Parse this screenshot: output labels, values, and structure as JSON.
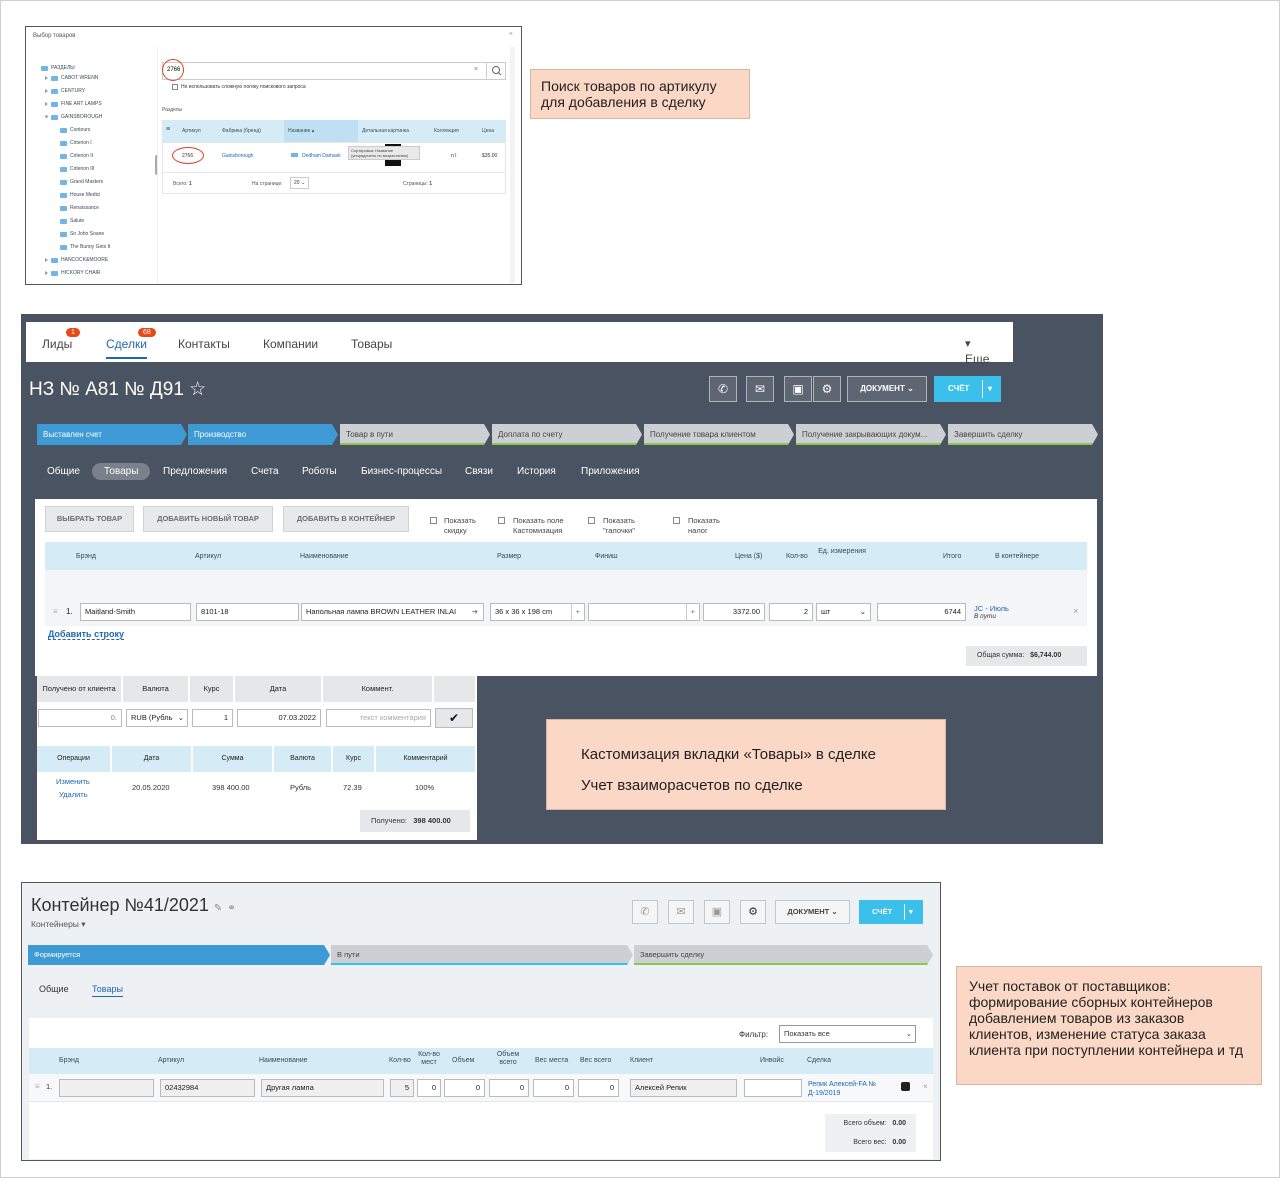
{
  "panel1": {
    "dialog_title": "Выбор товаров",
    "close": "×",
    "tree": [
      "РАЗДЕЛЫ",
      "CABOT WRENN",
      "CENTURY",
      "FINE ART LAMPS",
      "GAINSBOROUGH",
      "Contours",
      "Criterion I",
      "Criterion II",
      "Criterion III",
      "Grand Masters",
      "House Medici",
      "Renaissance",
      "Salute",
      "Sir John Soane",
      "The Bunny Gets It",
      "HANCOCK&MOORE",
      "HICKORY CHAIR"
    ],
    "search_value": "2766",
    "checkbox_label": "Не использовать сложную логику поискового запроса",
    "section_label": "Разделы",
    "columns": [
      "Артикул",
      "Фабрика (бренд)",
      "Название",
      "Детальная картинка",
      "Коллекция",
      "Цена"
    ],
    "row": {
      "article": "2766",
      "brand": "Gainsborough",
      "name": "Dedham Damask",
      "collection": "n I",
      "price": "$35.00"
    },
    "tooltip": "Сортировка: Название (упорядочено по возрастанию)",
    "footer": {
      "total_label": "Всего:",
      "total": "1",
      "per_page_label": "На странице:",
      "per_page": "20",
      "pages_label": "Страницы:",
      "pages": "1"
    }
  },
  "note1": "Поиск товаров по артикулу для добавления в сделку",
  "panel2": {
    "tabs": [
      "Лиды",
      "Сделки",
      "Контакты",
      "Компании",
      "Товары",
      "Еще"
    ],
    "badges": [
      "1",
      "68"
    ],
    "title": "НЗ № А81 № Д91 ☆",
    "doc_button": "ДОКУМЕНТ",
    "schet_button": "СЧЁТ",
    "stages": [
      "Выставлен счет",
      "Производство",
      "Товар в пути",
      "Доплата по счету",
      "Получение товара клиентом",
      "Получение закрывающих докум...",
      "Завершить сделку"
    ],
    "subtabs": [
      "Общие",
      "Товары",
      "Предложения",
      "Счета",
      "Роботы",
      "Бизнес-процессы",
      "Связи",
      "История",
      "Приложения"
    ],
    "buttons": [
      "ВЫБРАТЬ ТОВАР",
      "ДОБАВИТЬ НОВЫЙ ТОВАР",
      "ДОБАВИТЬ В КОНТЕЙНЕР"
    ],
    "checkboxes": [
      "Показать скидку",
      "Показать поле Кастомизация",
      "Показать \"галочки\"",
      "Показать налог"
    ],
    "columns": [
      "Брэнд",
      "Артикул",
      "Наименование",
      "Размер",
      "Финиш",
      "Цена ($)",
      "Кол-во",
      "Ед. измерения",
      "Итого",
      "В контейнере"
    ],
    "row": {
      "num": "1.",
      "brand": "Maitland-Smith",
      "article": "8101-18",
      "name": "Напольная лампа BROWN LEATHER INLAI",
      "size": "36 x 36 x 198 cm",
      "finish": "",
      "price": "3372.00",
      "qty": "2",
      "unit": "шт",
      "total": "6744",
      "container": "JC - Июль",
      "container_status": "В пути"
    },
    "add_row": "Добавить строку",
    "sum_label": "Общая сумма:",
    "sum_value": "$6,744.00",
    "pay_headers": [
      "Получено от клиента",
      "Валюта",
      "Курс",
      "Дата",
      "Коммент."
    ],
    "pay_inputs": {
      "received": "0.",
      "currency": "RUB (Рубль",
      "rate": "1",
      "date": "07.03.2022",
      "comment_placeholder": "текст комментария"
    },
    "ops_headers": [
      "Операции",
      "Дата",
      "Сумма",
      "Валюта",
      "Курс",
      "Комментарий"
    ],
    "ops_row": {
      "edit": "Изменить",
      "delete": "Удалить",
      "date": "20.05.2020",
      "sum": "398 400.00",
      "currency": "Рубль",
      "rate": "72.39",
      "comment": "100%"
    },
    "received_label": "Получено:",
    "received_value": "398 400.00"
  },
  "note2": [
    "Кастомизация вкладки «Товары» в сделке",
    "Учет взаиморасчетов по сделке"
  ],
  "panel3": {
    "title": "Контейнер №41/2021",
    "breadcrumb": "Контейнеры",
    "doc_button": "ДОКУМЕНТ",
    "schet_button": "СЧЁТ",
    "stages": [
      "Формируется",
      "В пути",
      "Завершить сделку"
    ],
    "subtabs": [
      "Общие",
      "Товары"
    ],
    "filter_label": "Фильтр:",
    "filter_value": "Показать все",
    "columns": [
      "Брэнд",
      "Артикул",
      "Наименование",
      "Кол-во",
      "Кол-во мест",
      "Объем",
      "Объем всего",
      "Вес места",
      "Вес всего",
      "Клиент",
      "Инвойс",
      "Сделка"
    ],
    "row": {
      "num": "1.",
      "brand": "",
      "article": "02432984",
      "name": "Другая лампа",
      "qty": "5",
      "places": "0",
      "volume": "0",
      "volume_total": "0",
      "weight_place": "0",
      "weight_total": "0",
      "client": "Алексей Репик",
      "invoice": "",
      "deal": "Репик Алексей-FA № Д-19/2019"
    },
    "total_volume_label": "Всего объем:",
    "total_volume": "0.00",
    "total_weight_label": "Всего вес:",
    "total_weight": "0.00"
  },
  "note3": "Учет поставок от поставщиков: формирование сборных контейнеров добавлением товаров из заказов клиентов, изменение статуса заказа клиента при поступлении контейнера и тд",
  "colors": {
    "accent": "#3bc0ec",
    "stage_done": "#3d9ad4",
    "note_bg": "#fbd7c6",
    "panel_bg": "#4a5361",
    "table_head": "#d5ecf7",
    "badge": "#e64a19"
  }
}
